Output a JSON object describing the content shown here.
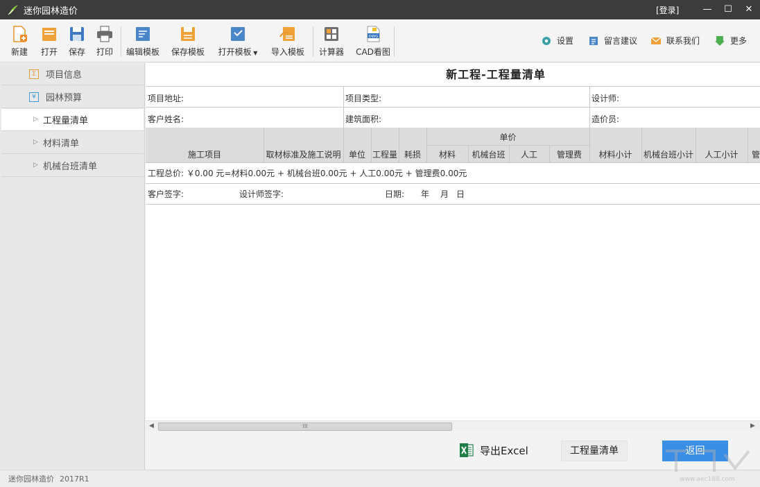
{
  "window": {
    "title": "迷你园林造价",
    "login": "[登录]",
    "minimize": "—",
    "maximize": "☐",
    "close": "✕"
  },
  "toolbar": {
    "new": "新建",
    "open": "打开",
    "save": "保存",
    "print": "打印",
    "edit_template": "编辑模板",
    "save_template": "保存模板",
    "open_template": "打开模板",
    "import_template": "导入模板",
    "calculator": "计算器",
    "cad": "CAD看图",
    "cad_badge": "DWG",
    "settings": "设置",
    "feedback": "留言建议",
    "contact": "联系我们",
    "more": "更多"
  },
  "sidebar": {
    "items": [
      {
        "label": "项目信息",
        "icon": "Σ"
      },
      {
        "label": "园林预算",
        "icon": "¥"
      },
      {
        "label": "工程量清单"
      },
      {
        "label": "材料清单"
      },
      {
        "label": "机械台班清单"
      }
    ]
  },
  "sheet": {
    "title": "新工程-工程量清单",
    "project_address": "项目地址:",
    "project_type": "项目类型:",
    "designer": "设计师:",
    "customer_name": "客户姓名:",
    "building_area": "建筑面积:",
    "cost_engineer": "造价员:",
    "unit_price_group": "单价",
    "columns": [
      "施工项目",
      "取材标准及施工说明",
      "单位",
      "工程量",
      "耗损",
      "材料",
      "机械台班",
      "人工",
      "管理费",
      "材料小计",
      "机械台班小计",
      "人工小计",
      "管"
    ],
    "total_line": "工程总价: ￥0.00 元=材料0.00元 + 机械台班0.00元 + 人工0.00元 + 管理费0.00元",
    "customer_sign": "客户签字:",
    "designer_sign": "设计师签字:",
    "date_label": "日期:",
    "year": "年",
    "month": "月",
    "day": "日"
  },
  "scrollbar": {
    "grip": "III"
  },
  "bottom": {
    "export_excel": "导出Excel",
    "quantity_list": "工程量清单",
    "back": "返回"
  },
  "status": {
    "app_name": "迷你园林造价",
    "version": "2017R1"
  },
  "watermark": {
    "text": "www.aec188.com"
  },
  "colors": {
    "titlebar": "#3c3c3c",
    "accent_blue": "#3a8ee6",
    "excel_green": "#1e7e45",
    "icon_orange": "#f0a23a",
    "icon_blue": "#4a86c8"
  }
}
